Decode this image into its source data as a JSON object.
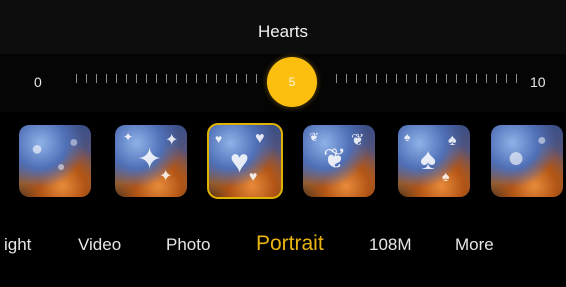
{
  "filter": {
    "name": "Hearts"
  },
  "slider": {
    "min_label": "0",
    "max_label": "10",
    "value": "5"
  },
  "thumbnails": [
    {
      "effect": "bokeh-circles-icon",
      "glyph": ""
    },
    {
      "effect": "bokeh-stars-icon",
      "glyph": "✦"
    },
    {
      "effect": "bokeh-hearts-icon",
      "glyph": "♥"
    },
    {
      "effect": "bokeh-butterflies-icon",
      "glyph": "❦"
    },
    {
      "effect": "bokeh-trees-icon",
      "glyph": "♠"
    },
    {
      "effect": "bokeh-drops-icon",
      "glyph": "💧"
    }
  ],
  "modes": {
    "partial": "ight",
    "video": "Video",
    "photo": "Photo",
    "portrait": "Portrait",
    "hundred_eight_m": "108M",
    "more": "More"
  },
  "colors": {
    "accent": "#fcbf10",
    "active_mode": "#eab512",
    "background": "#000000"
  }
}
